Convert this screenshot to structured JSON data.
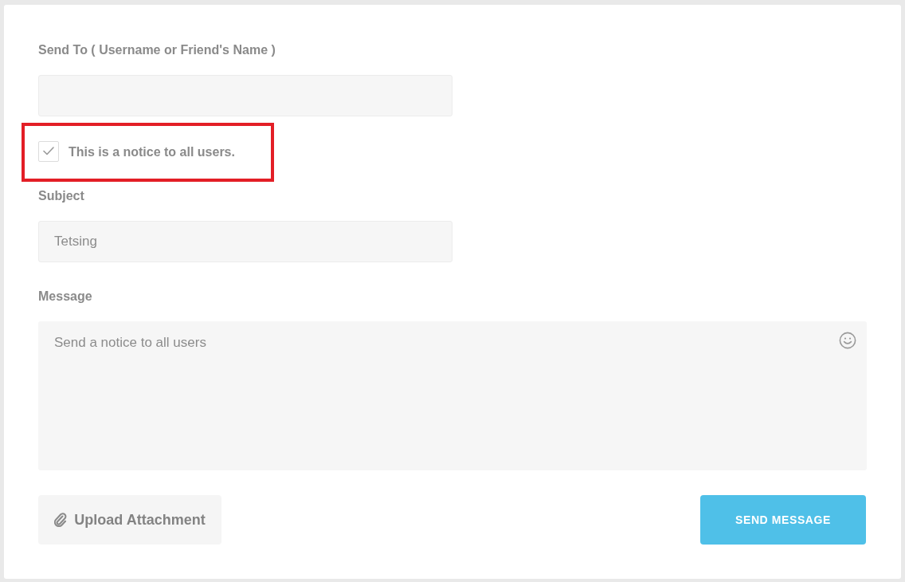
{
  "send_to": {
    "label": "Send To ( Username or Friend's Name )"
  },
  "notice": {
    "label": "This is a notice to all users.",
    "checked": true,
    "highlighted": true
  },
  "subject": {
    "label": "Subject",
    "value": "Tetsing"
  },
  "message": {
    "label": "Message",
    "placeholder": "Send a notice to all users"
  },
  "buttons": [
    {
      "kind": "upload",
      "label": "Upload Attachment"
    },
    {
      "kind": "primary",
      "label": "SEND MESSAGE"
    }
  ]
}
